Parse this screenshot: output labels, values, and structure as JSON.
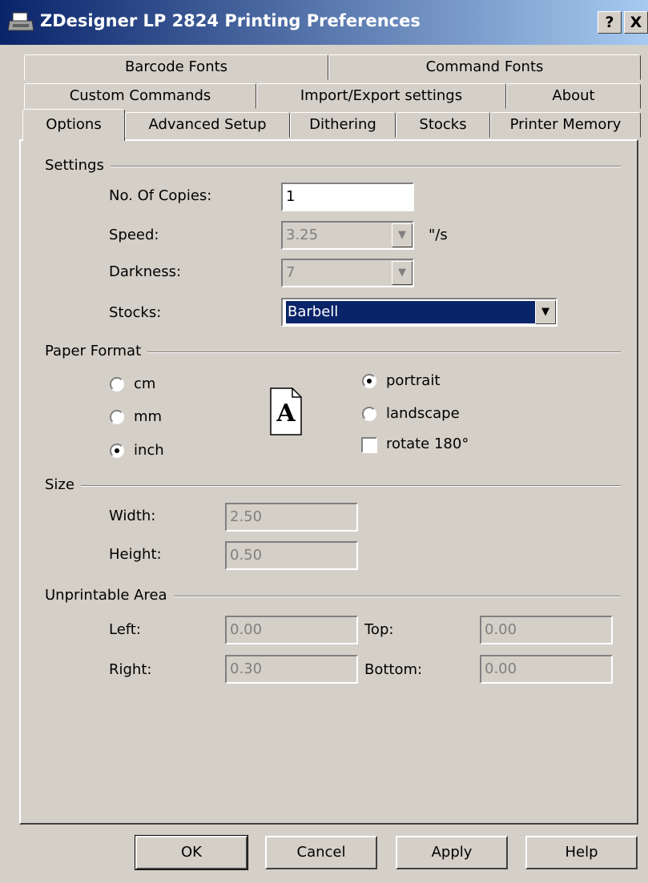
{
  "window": {
    "title": "ZDesigner LP 2824 Printing Preferences",
    "help_label": "?",
    "close_label": "X"
  },
  "tabs": {
    "row1": [
      "Barcode Fonts",
      "Command Fonts"
    ],
    "row2": [
      "Custom Commands",
      "Import/Export settings",
      "About"
    ],
    "row3": [
      "Options",
      "Advanced Setup",
      "Dithering",
      "Stocks",
      "Printer Memory"
    ],
    "active": "Options"
  },
  "settings": {
    "group_label": "Settings",
    "copies_label": "No. Of Copies:",
    "copies_value": "1",
    "speed_label": "Speed:",
    "speed_value": "3.25",
    "speed_unit": "\"/s",
    "darkness_label": "Darkness:",
    "darkness_value": "7",
    "stocks_label": "Stocks:",
    "stocks_value": "Barbell"
  },
  "paper_format": {
    "group_label": "Paper Format",
    "units": [
      {
        "label": "cm",
        "checked": false
      },
      {
        "label": "mm",
        "checked": false
      },
      {
        "label": "inch",
        "checked": true
      }
    ],
    "orientation": [
      {
        "label": "portrait",
        "checked": true
      },
      {
        "label": "landscape",
        "checked": false
      }
    ],
    "rotate_label": "rotate 180°",
    "rotate_checked": false,
    "icon_letter": "A"
  },
  "size": {
    "group_label": "Size",
    "width_label": "Width:",
    "width_value": "2.50",
    "height_label": "Height:",
    "height_value": "0.50"
  },
  "unprintable": {
    "group_label": "Unprintable Area",
    "left_label": "Left:",
    "left_value": "0.00",
    "top_label": "Top:",
    "top_value": "0.00",
    "right_label": "Right:",
    "right_value": "0.30",
    "bottom_label": "Bottom:",
    "bottom_value": "0.00"
  },
  "buttons": {
    "ok": "OK",
    "cancel": "Cancel",
    "apply": "Apply",
    "help": "Help"
  }
}
